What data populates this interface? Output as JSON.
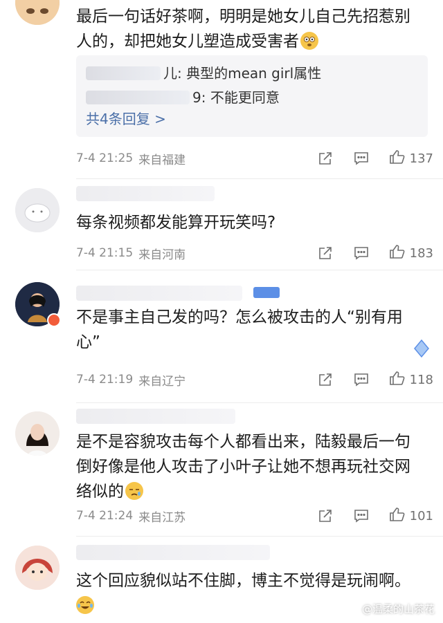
{
  "comments": [
    {
      "text": "最后一句话好茶啊，明明是她女儿自己先招惹别人的，却把她女儿塑造成受害者",
      "replies": [
        {
          "name_tail": "儿:",
          "text": "典型的mean girl属性"
        },
        {
          "name_tail": "9:",
          "text": "不能更同意"
        }
      ],
      "more_replies": "共4条回复 >",
      "time": "7-4 21:25",
      "location": "来自福建",
      "likes": "137"
    },
    {
      "text": "每条视频都发能算开玩笑吗?",
      "time": "7-4 21:15",
      "location": "来自河南",
      "likes": "183"
    },
    {
      "text": "不是事主自己发的吗？怎么被攻击的人“别有用心”",
      "time": "7-4 21:19",
      "location": "来自辽宁",
      "likes": "118"
    },
    {
      "text": "是不是容貌攻击每个人都看出来，陆毅最后一句倒好像是他人攻击了小叶子让她不想再玩社交网络似的",
      "time": "7-4 21:24",
      "location": "来自江苏",
      "likes": "101"
    },
    {
      "text": "这个回应貌似站不住脚，博主不觉得是玩闹啊。"
    }
  ],
  "watermark": "@温柔的山茶花",
  "icons": [
    "share-icon",
    "comment-icon",
    "like-icon"
  ],
  "colors": {
    "link": "#4a6fa8",
    "meta": "#8a8a8a",
    "reply_bg": "#f5f5f7",
    "badge": "#5c8fe6"
  }
}
